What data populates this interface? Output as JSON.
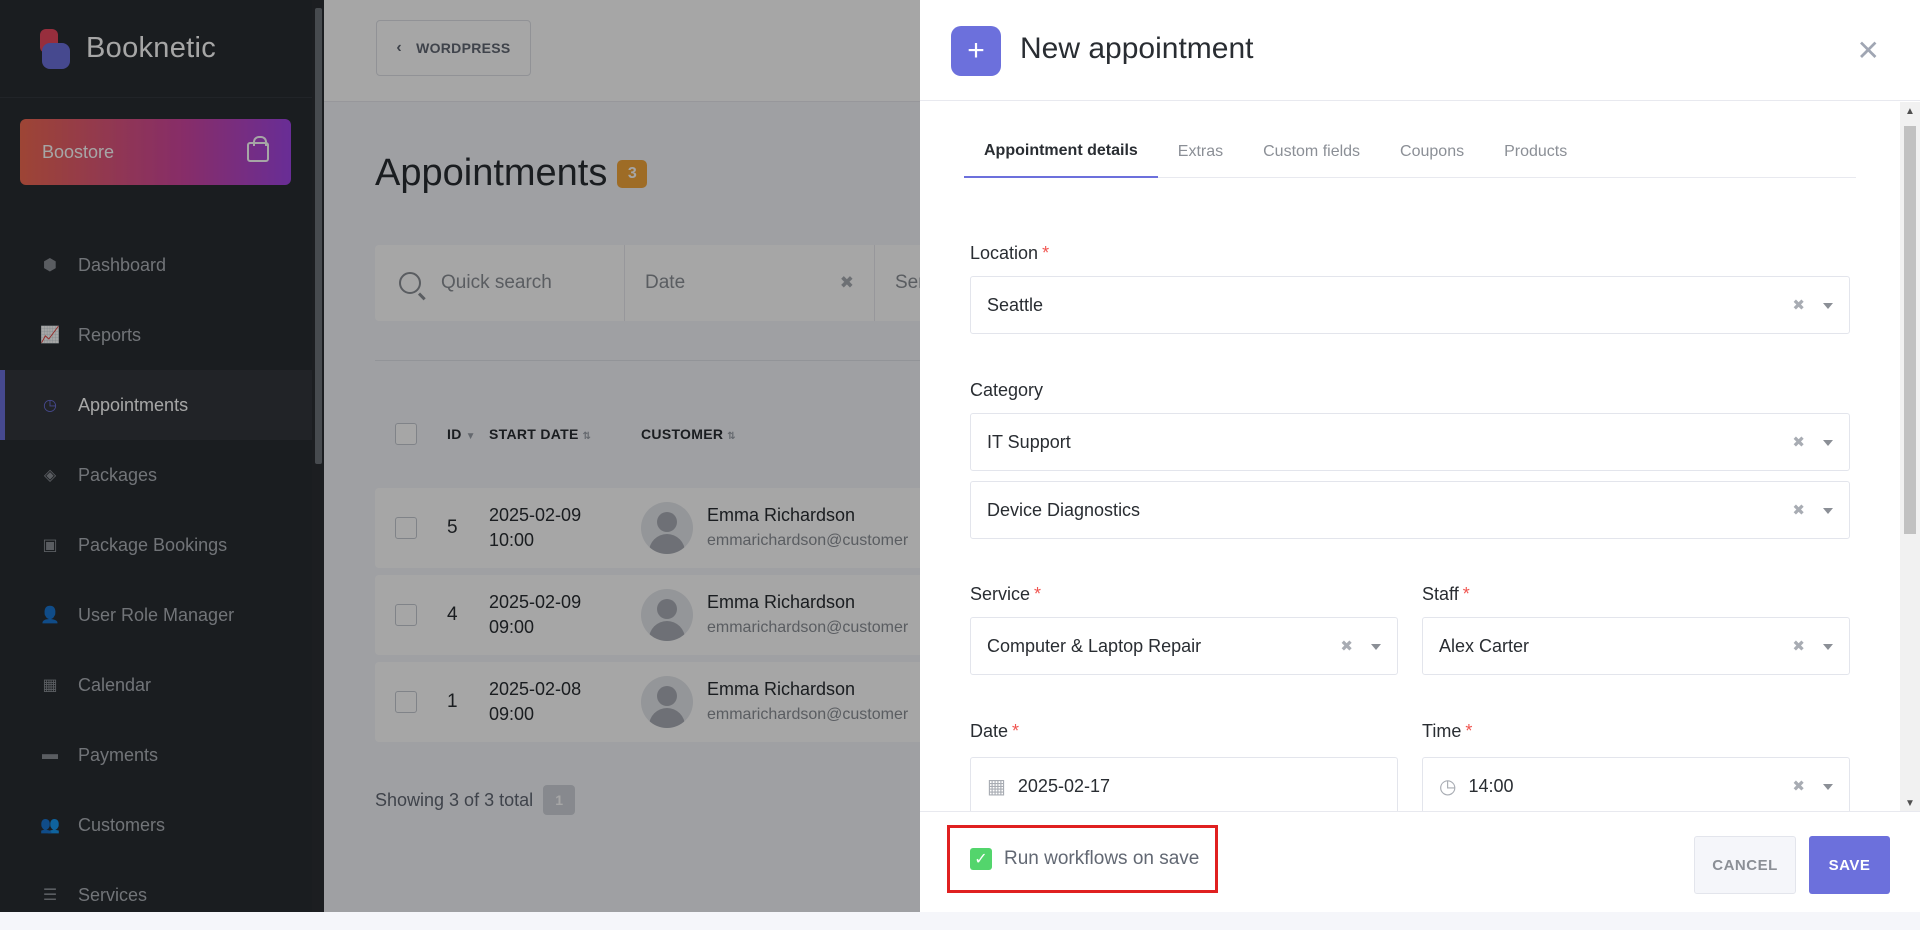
{
  "app": {
    "name": "Booknetic"
  },
  "boostore": {
    "label": "Boostore",
    "icon": "shopping-bag-icon"
  },
  "sidebar": {
    "items": [
      {
        "label": "Dashboard",
        "icon": "cube-icon",
        "glyph": "⬢"
      },
      {
        "label": "Reports",
        "icon": "chart-icon",
        "glyph": "📈"
      },
      {
        "label": "Appointments",
        "icon": "clock-icon",
        "glyph": "◷",
        "active": true
      },
      {
        "label": "Packages",
        "icon": "boxes-icon",
        "glyph": "◈"
      },
      {
        "label": "Package Bookings",
        "icon": "box-open-icon",
        "glyph": "▣"
      },
      {
        "label": "User Role Manager",
        "icon": "user-plus-icon",
        "glyph": "👤"
      },
      {
        "label": "Calendar",
        "icon": "calendar-icon",
        "glyph": "▦"
      },
      {
        "label": "Payments",
        "icon": "wallet-icon",
        "glyph": "▬"
      },
      {
        "label": "Customers",
        "icon": "users-icon",
        "glyph": "👥"
      },
      {
        "label": "Services",
        "icon": "list-icon",
        "glyph": "☰"
      }
    ]
  },
  "header": {
    "wordpress_label": "WORDPRESS"
  },
  "page": {
    "title": "Appointments",
    "count": "3"
  },
  "filters": {
    "search_placeholder": "Quick search",
    "date_placeholder": "Date",
    "service_placeholder": "Ser"
  },
  "table": {
    "headers": {
      "id": "ID",
      "start_date": "START DATE",
      "customer": "CUSTOMER"
    },
    "rows": [
      {
        "id": "5",
        "date": "2025-02-09",
        "time": "10:00",
        "name": "Emma Richardson",
        "email": "emmarichardson@customer"
      },
      {
        "id": "4",
        "date": "2025-02-09",
        "time": "09:00",
        "name": "Emma Richardson",
        "email": "emmarichardson@customer"
      },
      {
        "id": "1",
        "date": "2025-02-08",
        "time": "09:00",
        "name": "Emma Richardson",
        "email": "emmarichardson@customer"
      }
    ],
    "showing": "Showing 3 of 3 total",
    "page": "1"
  },
  "modal": {
    "title": "New appointment",
    "tabs": [
      "Appointment details",
      "Extras",
      "Custom fields",
      "Coupons",
      "Products"
    ],
    "fields": {
      "location": {
        "label": "Location",
        "value": "Seattle"
      },
      "category": {
        "label": "Category",
        "value": "IT Support",
        "sub_value": "Device Diagnostics"
      },
      "service": {
        "label": "Service",
        "value": "Computer & Laptop Repair"
      },
      "staff": {
        "label": "Staff",
        "value": "Alex Carter"
      },
      "date": {
        "label": "Date",
        "value": "2025-02-17"
      },
      "time": {
        "label": "Time",
        "value": "14:00"
      }
    },
    "footer": {
      "workflow_label": "Run workflows on save",
      "workflow_checked": true,
      "cancel": "CANCEL",
      "save": "SAVE"
    }
  },
  "colors": {
    "accent": "#6c70dc",
    "sidebar_bg": "#292d32",
    "required": "#f0544f",
    "check": "#53d56c",
    "highlight_border": "#e02020"
  }
}
